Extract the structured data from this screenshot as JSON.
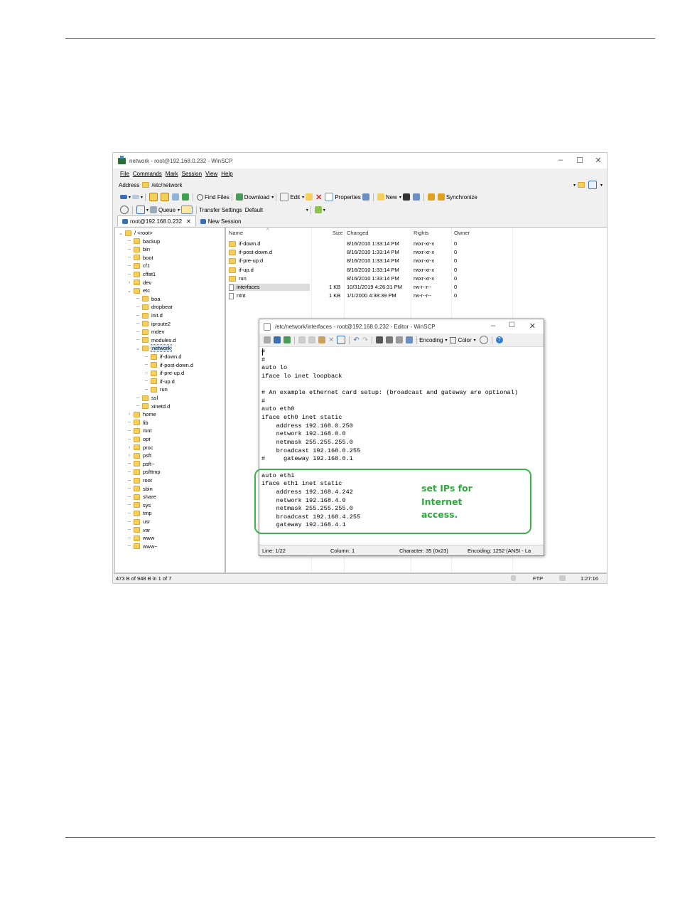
{
  "window": {
    "title": "network - root@192.168.0.232 - WinSCP",
    "controls": [
      "–",
      "☐",
      "✕"
    ]
  },
  "menu": [
    "File",
    "Commands",
    "Mark",
    "Session",
    "View",
    "Help"
  ],
  "address": {
    "label": "Address",
    "value": "/etc/network"
  },
  "toolbar1": {
    "find_files": "Find Files",
    "download": "Download",
    "edit": "Edit",
    "properties": "Properties",
    "new": "New",
    "synchronize": "Synchronize"
  },
  "toolbar2": {
    "queue": "Queue",
    "transfer_settings": "Transfer Settings",
    "transfer_value": "Default"
  },
  "tabs": {
    "session": "root@192.168.0.232",
    "new_session": "New Session"
  },
  "tree": [
    {
      "label": "/ <root>",
      "level": 0,
      "exp": "v"
    },
    {
      "label": "backup",
      "level": 1,
      "exp": ""
    },
    {
      "label": "bin",
      "level": 1,
      "exp": ""
    },
    {
      "label": "boot",
      "level": 1,
      "exp": ""
    },
    {
      "label": "cf1",
      "level": 1,
      "exp": ""
    },
    {
      "label": "cffat1",
      "level": 1,
      "exp": ""
    },
    {
      "label": "dev",
      "level": 1,
      "exp": ">"
    },
    {
      "label": "etc",
      "level": 1,
      "exp": "v"
    },
    {
      "label": "boa",
      "level": 2,
      "exp": ""
    },
    {
      "label": "dropbear",
      "level": 2,
      "exp": ""
    },
    {
      "label": "init.d",
      "level": 2,
      "exp": ""
    },
    {
      "label": "iproute2",
      "level": 2,
      "exp": ""
    },
    {
      "label": "mdev",
      "level": 2,
      "exp": ""
    },
    {
      "label": "modules.d",
      "level": 2,
      "exp": ""
    },
    {
      "label": "network",
      "level": 2,
      "exp": "v",
      "selected": true
    },
    {
      "label": "if-down.d",
      "level": 3,
      "exp": ""
    },
    {
      "label": "if-post-down.d",
      "level": 3,
      "exp": ""
    },
    {
      "label": "if-pre-up.d",
      "level": 3,
      "exp": ""
    },
    {
      "label": "if-up.d",
      "level": 3,
      "exp": ""
    },
    {
      "label": "run",
      "level": 3,
      "exp": ""
    },
    {
      "label": "ssl",
      "level": 2,
      "exp": ""
    },
    {
      "label": "xinetd.d",
      "level": 2,
      "exp": ""
    },
    {
      "label": "home",
      "level": 1,
      "exp": ">"
    },
    {
      "label": "lib",
      "level": 1,
      "exp": ""
    },
    {
      "label": "mnt",
      "level": 1,
      "exp": ""
    },
    {
      "label": "opt",
      "level": 1,
      "exp": ""
    },
    {
      "label": "proc",
      "level": 1,
      "exp": ">"
    },
    {
      "label": "psft",
      "level": 1,
      "exp": ">"
    },
    {
      "label": "psft~",
      "level": 1,
      "exp": ""
    },
    {
      "label": "psfttmp",
      "level": 1,
      "exp": ""
    },
    {
      "label": "root",
      "level": 1,
      "exp": ""
    },
    {
      "label": "sbin",
      "level": 1,
      "exp": ""
    },
    {
      "label": "share",
      "level": 1,
      "exp": ""
    },
    {
      "label": "sys",
      "level": 1,
      "exp": ""
    },
    {
      "label": "tmp",
      "level": 1,
      "exp": ""
    },
    {
      "label": "usr",
      "level": 1,
      "exp": ""
    },
    {
      "label": "var",
      "level": 1,
      "exp": ""
    },
    {
      "label": "www",
      "level": 1,
      "exp": ""
    },
    {
      "label": "www~",
      "level": 1,
      "exp": ""
    }
  ],
  "filelist": {
    "columns": {
      "name": "Name",
      "size": "Size",
      "changed": "Changed",
      "rights": "Rights",
      "owner": "Owner"
    },
    "rows": [
      {
        "name": "if-down.d",
        "type": "folder",
        "size": "",
        "changed": "8/16/2010 1:33:14 PM",
        "rights": "rwxr-xr-x",
        "owner": "0"
      },
      {
        "name": "if-post-down.d",
        "type": "folder",
        "size": "",
        "changed": "8/16/2010 1:33:14 PM",
        "rights": "rwxr-xr-x",
        "owner": "0"
      },
      {
        "name": "if-pre-up.d",
        "type": "folder",
        "size": "",
        "changed": "8/16/2010 1:33:14 PM",
        "rights": "rwxr-xr-x",
        "owner": "0"
      },
      {
        "name": "if-up.d",
        "type": "folder",
        "size": "",
        "changed": "8/16/2010 1:33:14 PM",
        "rights": "rwxr-xr-x",
        "owner": "0"
      },
      {
        "name": "run",
        "type": "folder",
        "size": "",
        "changed": "8/16/2010 1:33:14 PM",
        "rights": "rwxr-xr-x",
        "owner": "0"
      },
      {
        "name": "interfaces",
        "type": "file",
        "size": "1 KB",
        "changed": "10/31/2019 4:26:31 PM",
        "rights": "rw-r--r--",
        "owner": "0",
        "selected": true
      },
      {
        "name": "ntnt",
        "type": "file",
        "size": "1 KB",
        "changed": "1/1/2000 4:38:39 PM",
        "rights": "rw-r--r--",
        "owner": "0"
      }
    ]
  },
  "status": {
    "left": "473 B of 948 B in 1 of 7",
    "protocol": "FTP",
    "time": "1:27:16"
  },
  "editor": {
    "title": "/etc/network/interfaces - root@192.168.0.232 - Editor - WinSCP",
    "encoding_label": "Encoding",
    "color_label": "Color",
    "lines": [
      "#",
      "#",
      "auto lo",
      "iface lo inet loopback",
      "",
      "# An example ethernet card setup: (broadcast and gateway are optional)",
      "#",
      "auto eth0",
      "iface eth0 inet static",
      "    address 192.168.0.250",
      "    network 192.168.0.0",
      "    netmask 255.255.255.0",
      "    broadcast 192.168.0.255",
      "#     gateway 192.168.0.1",
      "",
      "auto eth1",
      "iface eth1 inet static",
      "    address 192.168.4.242",
      "    network 192.168.4.0",
      "    netmask 255.255.255.0",
      "    broadcast 192.168.4.255",
      "    gateway 192.168.4.1"
    ],
    "status": {
      "line": "Line: 1/22",
      "column": "Column: 1",
      "character": "Character: 35 (0x23)",
      "encoding": "Encoding: 1252  (ANSI - La"
    }
  },
  "annotation": {
    "text": "set IPs for Internet access.",
    "color": "#2eaa3c"
  },
  "colors": {
    "folder": "#f5cf5c",
    "accent": "#3cb44b",
    "selection": "#cce4f7"
  }
}
